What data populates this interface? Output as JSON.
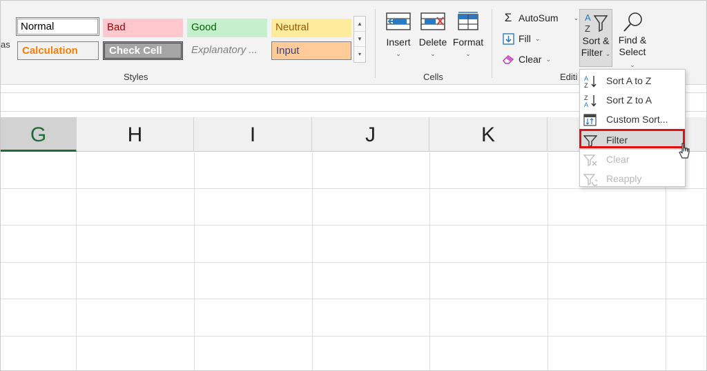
{
  "ribbon": {
    "cut_text": "as",
    "styles": {
      "normal": "Normal",
      "bad": "Bad",
      "good": "Good",
      "neutral": "Neutral",
      "calculation": "Calculation",
      "check_cell": "Check Cell",
      "explanatory": "Explanatory ...",
      "input": "Input",
      "group_label": "Styles"
    },
    "cells": {
      "insert": "Insert",
      "delete": "Delete",
      "format": "Format",
      "group_label": "Cells"
    },
    "editing": {
      "autosum": "AutoSum",
      "fill": "Fill",
      "clear": "Clear",
      "group_label_partial": "Editi",
      "sort_filter_line1": "Sort &",
      "sort_filter_line2": "Filter",
      "find_select_line1": "Find &",
      "find_select_line2": "Select"
    }
  },
  "columns": [
    "G",
    "H",
    "I",
    "J",
    "K"
  ],
  "selected_column": "G",
  "menu": {
    "items": [
      {
        "label": "Sort A to Z",
        "icon": "sort-az-icon",
        "disabled": false
      },
      {
        "label": "Sort Z to A",
        "icon": "sort-za-icon",
        "disabled": false
      },
      {
        "label": "Custom Sort...",
        "icon": "custom-sort-icon",
        "disabled": false
      },
      {
        "label": "Filter",
        "icon": "filter-icon",
        "disabled": false
      },
      {
        "label": "Clear",
        "icon": "clear-filter-icon",
        "disabled": true
      },
      {
        "label": "Reapply",
        "icon": "reapply-icon",
        "disabled": true
      }
    ],
    "highlighted": "Filter"
  },
  "colors": {
    "accent_green": "#1f6b3a",
    "highlight_red": "#e01010",
    "excel_blue": "#2b78c5"
  }
}
